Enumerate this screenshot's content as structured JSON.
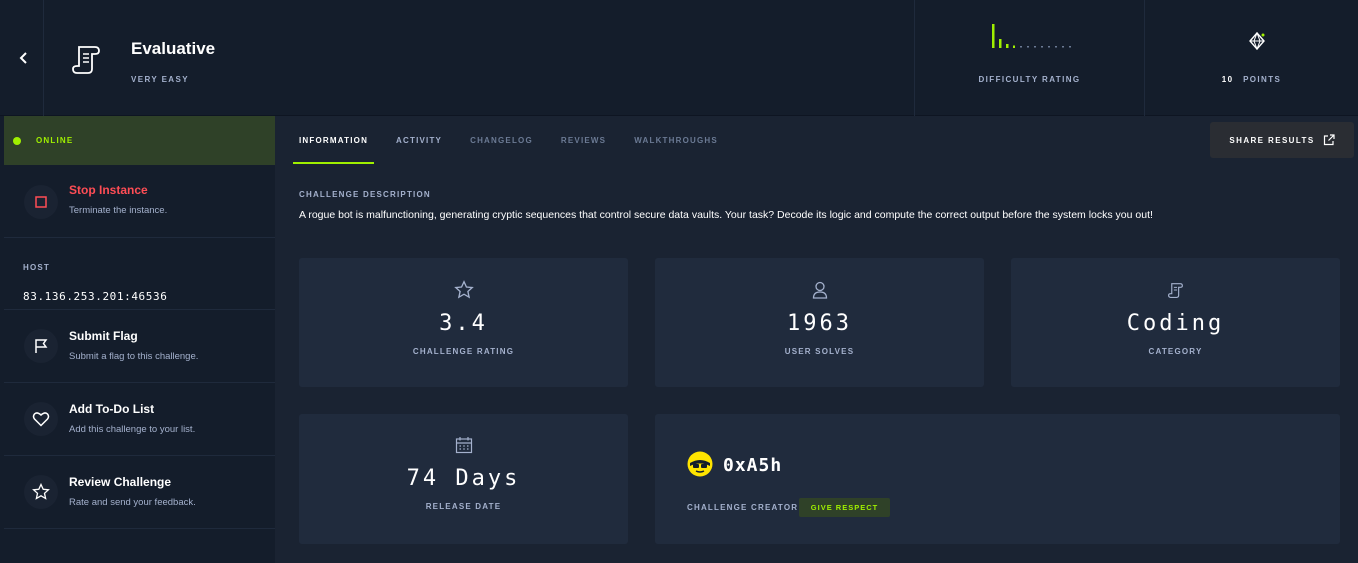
{
  "header": {
    "title": "Evaluative",
    "difficulty": "VERY EASY",
    "difficulty_rating_label": "DIFFICULTY RATING",
    "points_value": "10",
    "points_label": "POINTS",
    "icons": {
      "back": "chevron-left-icon",
      "title": "scroll-icon",
      "points": "diamond-icon"
    }
  },
  "sidebar": {
    "status": "ONLINE",
    "stop": {
      "title": "Stop Instance",
      "desc": "Terminate the instance."
    },
    "host": {
      "label": "HOST",
      "value": "83.136.253.201:46536"
    },
    "submit": {
      "title": "Submit Flag",
      "desc": "Submit a flag to this challenge."
    },
    "todo": {
      "title": "Add To-Do List",
      "desc": "Add this challenge to your list."
    },
    "review": {
      "title": "Review Challenge",
      "desc": "Rate and send your feedback."
    }
  },
  "tabs": [
    "INFORMATION",
    "ACTIVITY",
    "CHANGELOG",
    "REVIEWS",
    "WALKTHROUGHS"
  ],
  "share_label": "SHARE RESULTS",
  "description": {
    "label": "CHALLENGE DESCRIPTION",
    "text": "A rogue bot is malfunctioning, generating cryptic sequences that control secure data vaults. Your task? Decode its logic and compute the correct output before the system locks you out!"
  },
  "stats": {
    "rating": {
      "value": "3.4",
      "label": "CHALLENGE RATING"
    },
    "solves": {
      "value": "1963",
      "label": "USER SOLVES"
    },
    "category": {
      "value": "Coding",
      "label": "CATEGORY"
    },
    "release": {
      "value": "74 Days",
      "label": "RELEASE DATE"
    }
  },
  "creator": {
    "name": "0xA5h",
    "label": "CHALLENGE CREATOR",
    "respect_label": "GIVE RESPECT"
  },
  "colors": {
    "accent": "#9fef00",
    "stop": "#ff4d55",
    "bg": "#141d2b",
    "card": "#202b3d"
  }
}
